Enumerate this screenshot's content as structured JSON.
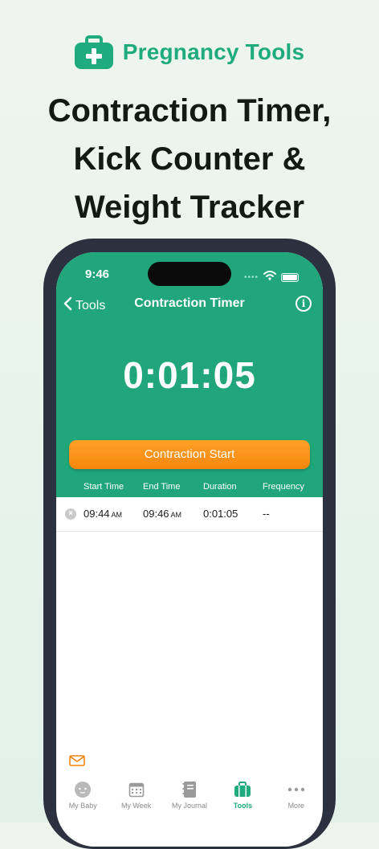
{
  "brand": {
    "title": "Pregnancy Tools"
  },
  "headline": {
    "line1": "Contraction Timer,",
    "line2": "Kick Counter &",
    "line3": "Weight Tracker"
  },
  "status_bar": {
    "time": "9:46"
  },
  "nav": {
    "back_label": "Tools",
    "title": "Contraction Timer",
    "info_icon": "i"
  },
  "timer": {
    "value": "0:01:05"
  },
  "start_button": {
    "label": "Contraction Start"
  },
  "columns": [
    "Start Time",
    "End Time",
    "Duration",
    "Frequency"
  ],
  "rows": [
    {
      "start_time": "09:44",
      "start_ampm": "AM",
      "end_time": "09:46",
      "end_ampm": "AM",
      "duration": "0:01:05",
      "frequency": "--"
    }
  ],
  "tabbar": {
    "items": [
      {
        "label": "My Baby",
        "icon": "baby-icon"
      },
      {
        "label": "My Week",
        "icon": "calendar-icon"
      },
      {
        "label": "My Journal",
        "icon": "journal-icon"
      },
      {
        "label": "Tools",
        "icon": "toolbox-icon",
        "active": true
      },
      {
        "label": "More",
        "icon": "more-icon"
      }
    ]
  },
  "colors": {
    "accent": "#20a67a",
    "button": "#f7860f",
    "brand_text": "#1fab7d"
  }
}
